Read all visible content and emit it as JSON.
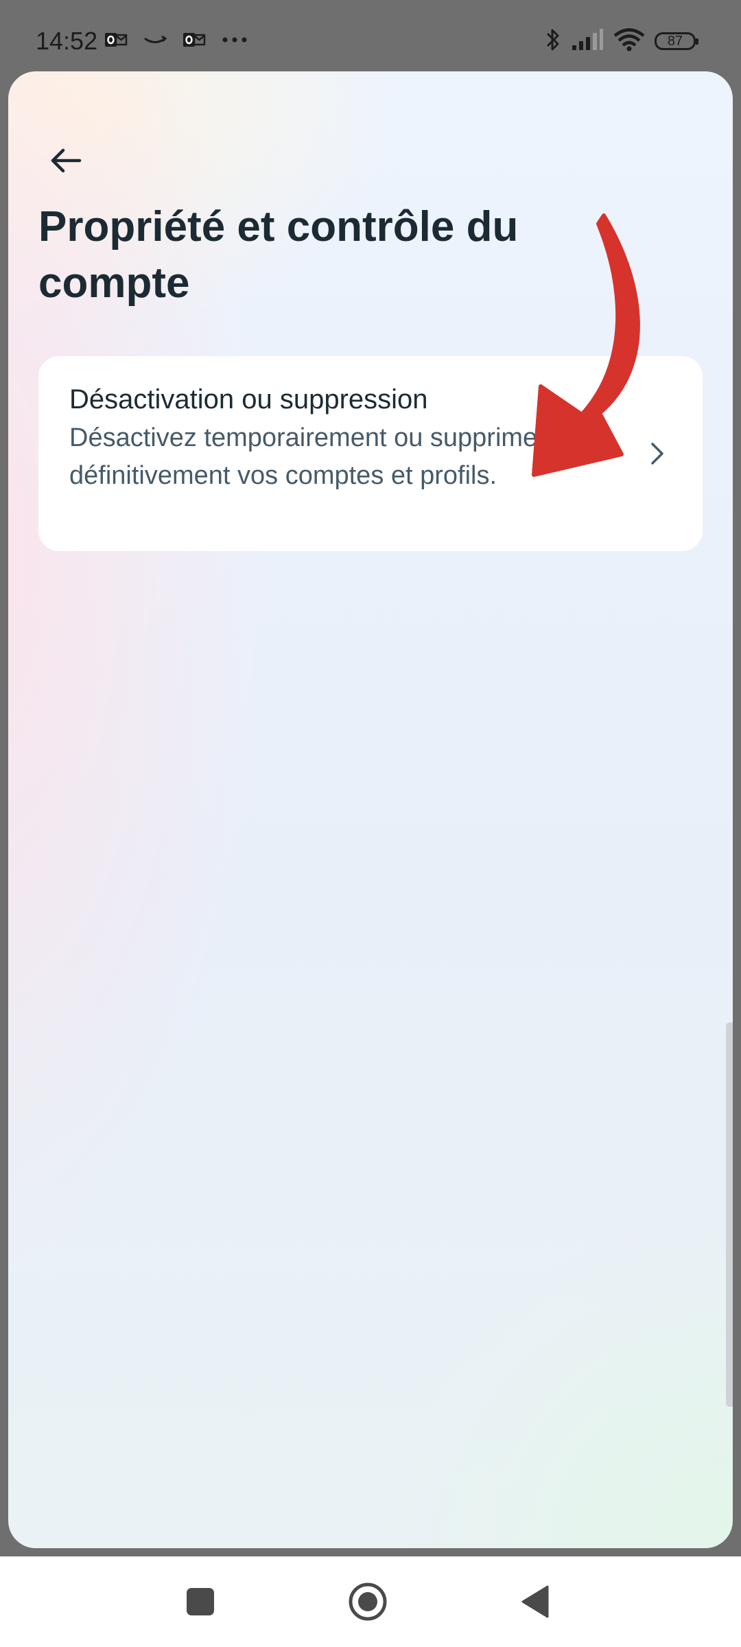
{
  "status_bar": {
    "time": "14:52",
    "battery": "87",
    "left_icons": [
      "outlook-icon",
      "amazon-icon",
      "outlook-icon",
      "more-notifications-icon"
    ],
    "right_icons": [
      "bluetooth-icon",
      "signal-icon",
      "wifi-icon",
      "battery-icon"
    ]
  },
  "header": {
    "back_icon": "arrow-left-icon",
    "title": "Propriété et contrôle du compte"
  },
  "options": [
    {
      "title": "Désactivation ou suppression",
      "description": "Désactivez temporairement ou supprimez définitivement vos comptes et profils.",
      "icon": "chevron-right-icon"
    }
  ],
  "annotation": {
    "icon": "red-arrow-annotation",
    "color": "#d6332c"
  },
  "nav_bar": {
    "buttons": [
      "recents-icon",
      "home-icon",
      "back-icon"
    ]
  },
  "colors": {
    "title_text": "#1c2b33",
    "secondary_text": "#465a69",
    "card_background": "#ffffff"
  }
}
